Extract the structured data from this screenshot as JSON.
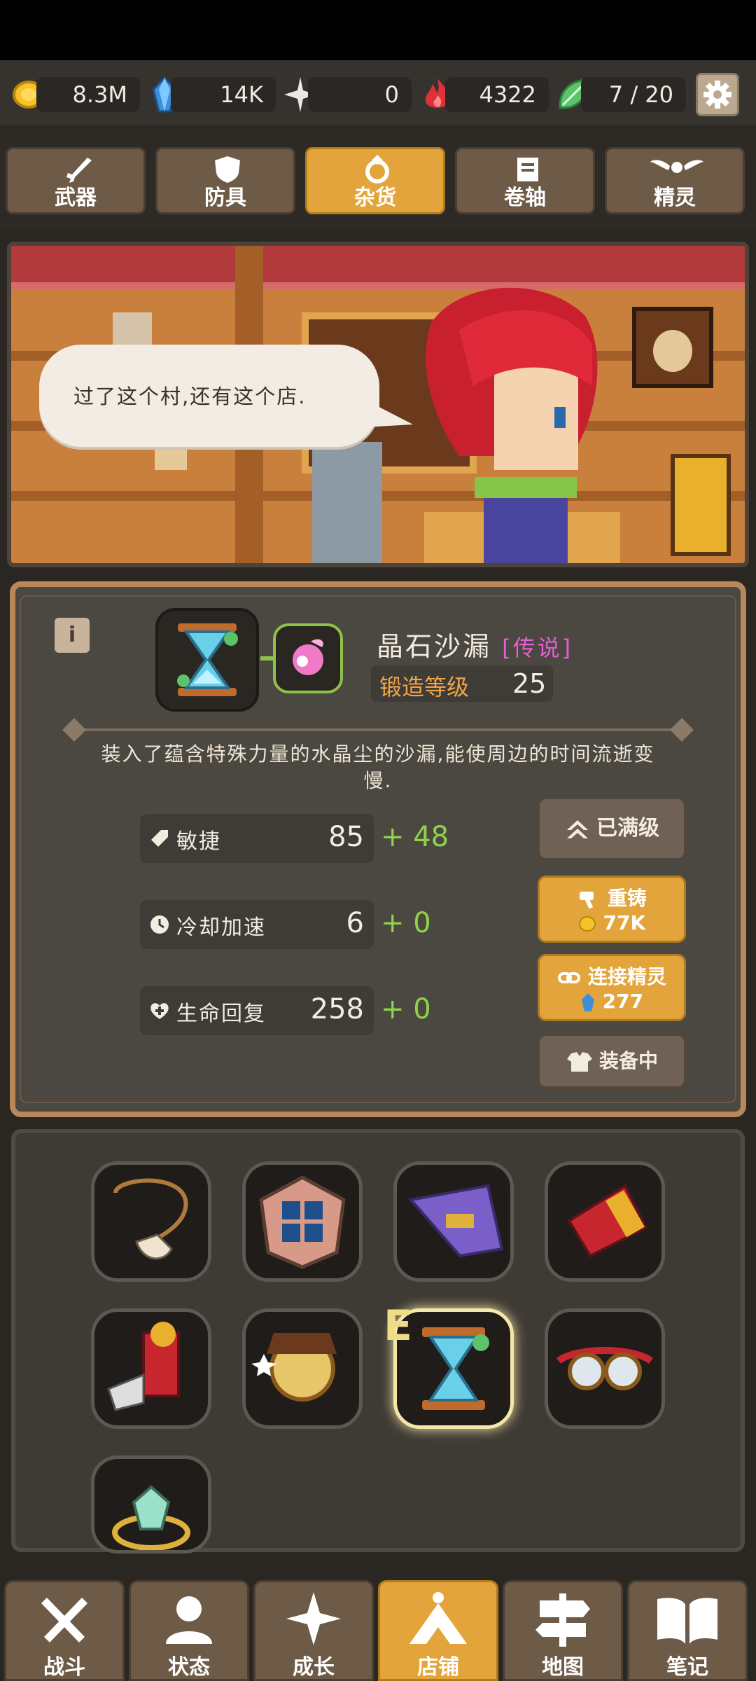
{
  "resources": {
    "gold": "8.3M",
    "gems": "14K",
    "stars": "0",
    "flames": "4322",
    "leaves": "7 / 20"
  },
  "tabs": [
    {
      "label": "武器"
    },
    {
      "label": "防具"
    },
    {
      "label": "杂货"
    },
    {
      "label": "卷轴"
    },
    {
      "label": "精灵"
    }
  ],
  "shopkeeper": {
    "speech": "过了这个村,还有这个店."
  },
  "item": {
    "name": "晶石沙漏",
    "rarity": "[传说]",
    "forge_label": "锻造等级",
    "forge_level": "25",
    "description": "装入了蕴含特殊力量的水晶尘的沙漏,能使周边的时间流逝变慢.",
    "stats": [
      {
        "label": "敏捷",
        "value": "85",
        "bonus": "+ 48"
      },
      {
        "label": "冷却加速",
        "value": "6",
        "bonus": "+ 0"
      },
      {
        "label": "生命回复",
        "value": "258",
        "bonus": "+ 0"
      }
    ]
  },
  "actions": {
    "maxed": "已满级",
    "reforge": "重铸",
    "reforge_cost": "77K",
    "link_spirit": "连接精灵",
    "link_cost": "277",
    "equipped": "装备中"
  },
  "inventory_badge": "E",
  "nav": [
    {
      "label": "战斗"
    },
    {
      "label": "状态"
    },
    {
      "label": "成长"
    },
    {
      "label": "店铺"
    },
    {
      "label": "地图"
    },
    {
      "label": "笔记"
    }
  ],
  "colors": {
    "accent_gold": "#e3a53b",
    "legendary": "#e35fd3",
    "bonus_green": "#8fd24a",
    "forge_orange": "#f0a545"
  }
}
